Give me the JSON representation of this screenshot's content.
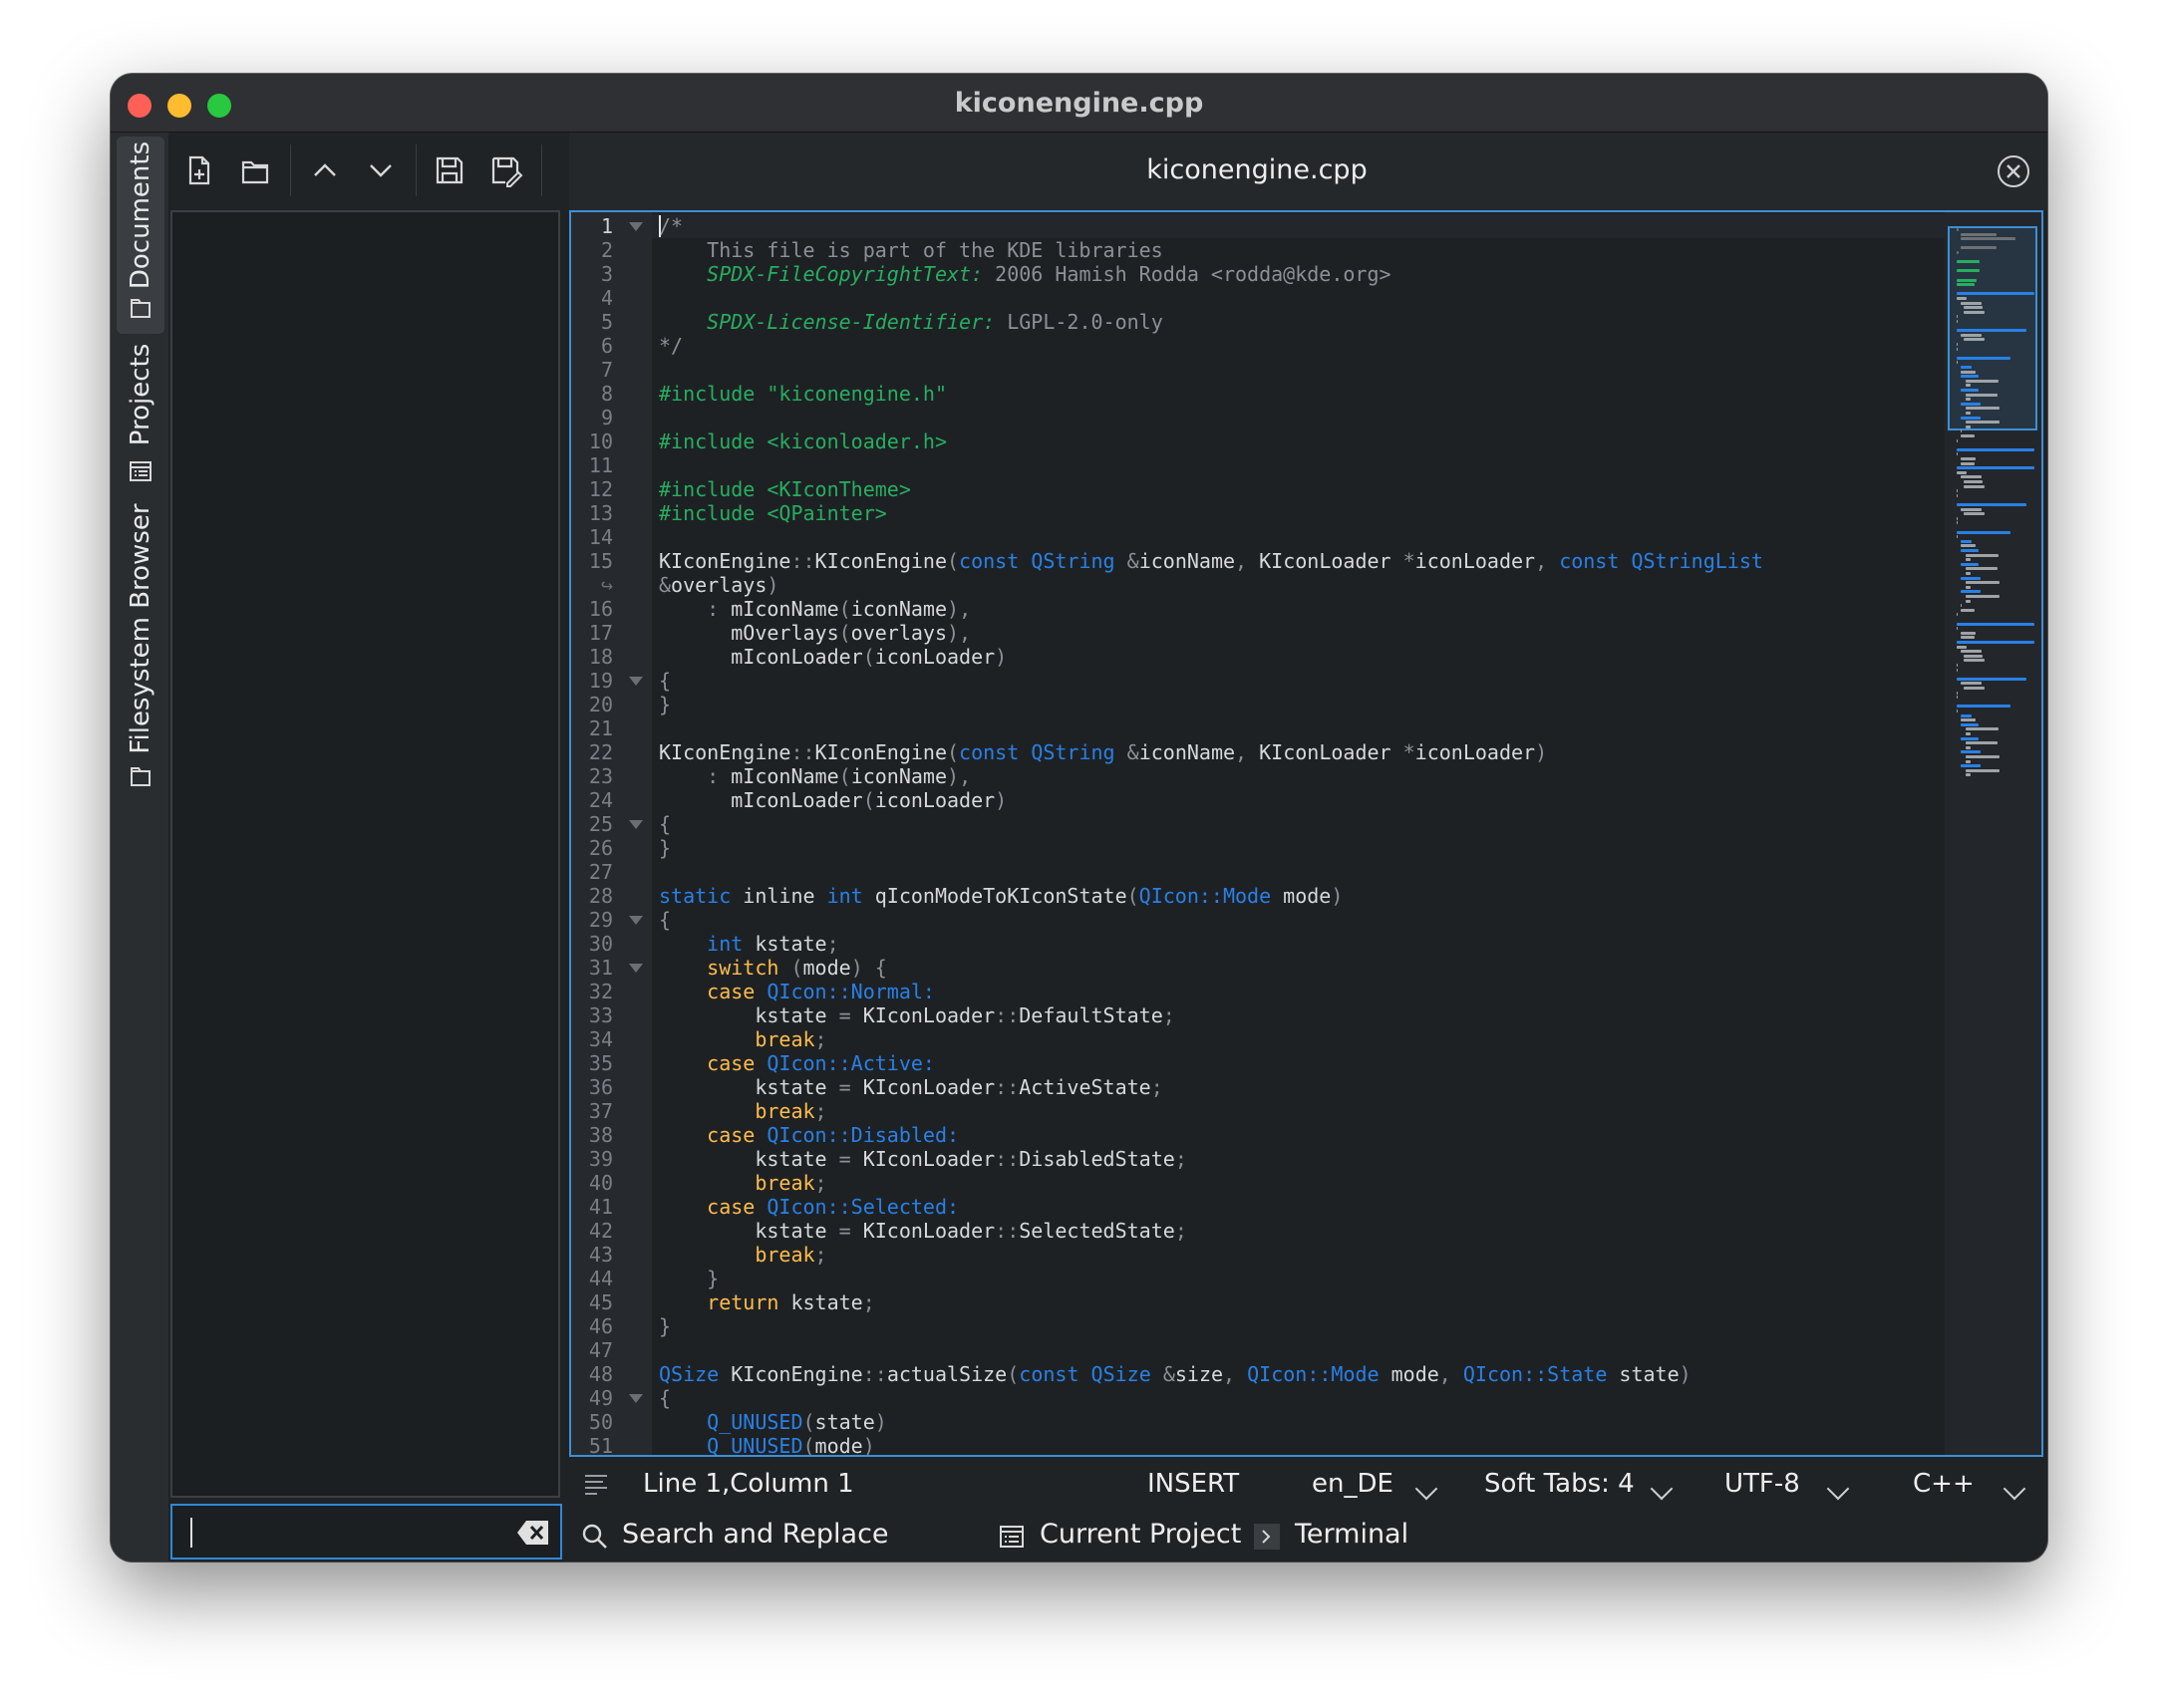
{
  "window": {
    "title": "kiconengine.cpp"
  },
  "sidebar": {
    "tabs": [
      {
        "label": "Documents",
        "icon": "document-stack-icon",
        "active": true
      },
      {
        "label": "Projects",
        "icon": "project-list-icon",
        "active": false
      },
      {
        "label": "Filesystem Browser",
        "icon": "folder-icon",
        "active": false
      }
    ]
  },
  "toolbar": {
    "buttons": [
      "new-document-icon",
      "open-folder-icon",
      "previous-document-icon",
      "next-document-icon",
      "save-icon",
      "save-as-icon"
    ]
  },
  "filter": {
    "value": ""
  },
  "editor": {
    "tab_title": "kiconengine.cpp",
    "current_line": 1,
    "lines": [
      {
        "n": "1",
        "text": "/*",
        "fold": true
      },
      {
        "n": "2",
        "text": "    This file is part of the KDE libraries"
      },
      {
        "n": "3",
        "text": "    SPDX-FileCopyrightText: 2006 Hamish Rodda <rodda@kde.org>"
      },
      {
        "n": "4",
        "text": ""
      },
      {
        "n": "5",
        "text": "    SPDX-License-Identifier: LGPL-2.0-only"
      },
      {
        "n": "6",
        "text": "*/"
      },
      {
        "n": "7",
        "text": ""
      },
      {
        "n": "8",
        "text": "#include \"kiconengine.h\""
      },
      {
        "n": "9",
        "text": ""
      },
      {
        "n": "10",
        "text": "#include <kiconloader.h>"
      },
      {
        "n": "11",
        "text": ""
      },
      {
        "n": "12",
        "text": "#include <KIconTheme>"
      },
      {
        "n": "13",
        "text": "#include <QPainter>"
      },
      {
        "n": "14",
        "text": ""
      },
      {
        "n": "15",
        "text": "KIconEngine::KIconEngine(const QString &iconName, KIconLoader *iconLoader, const QStringList"
      },
      {
        "n": "↪",
        "text": "&overlays)"
      },
      {
        "n": "16",
        "text": "    : mIconName(iconName),"
      },
      {
        "n": "17",
        "text": "      mOverlays(overlays),"
      },
      {
        "n": "18",
        "text": "      mIconLoader(iconLoader)"
      },
      {
        "n": "19",
        "text": "{",
        "fold": true
      },
      {
        "n": "20",
        "text": "}"
      },
      {
        "n": "21",
        "text": ""
      },
      {
        "n": "22",
        "text": "KIconEngine::KIconEngine(const QString &iconName, KIconLoader *iconLoader)"
      },
      {
        "n": "23",
        "text": "    : mIconName(iconName),"
      },
      {
        "n": "24",
        "text": "      mIconLoader(iconLoader)"
      },
      {
        "n": "25",
        "text": "{",
        "fold": true
      },
      {
        "n": "26",
        "text": "}"
      },
      {
        "n": "27",
        "text": ""
      },
      {
        "n": "28",
        "text": "static inline int qIconModeToKIconState(QIcon::Mode mode)"
      },
      {
        "n": "29",
        "text": "{",
        "fold": true
      },
      {
        "n": "30",
        "text": "    int kstate;"
      },
      {
        "n": "31",
        "text": "    switch (mode) {",
        "fold": true
      },
      {
        "n": "32",
        "text": "    case QIcon::Normal:"
      },
      {
        "n": "33",
        "text": "        kstate = KIconLoader::DefaultState;"
      },
      {
        "n": "34",
        "text": "        break;"
      },
      {
        "n": "35",
        "text": "    case QIcon::Active:"
      },
      {
        "n": "36",
        "text": "        kstate = KIconLoader::ActiveState;"
      },
      {
        "n": "37",
        "text": "        break;"
      },
      {
        "n": "38",
        "text": "    case QIcon::Disabled:"
      },
      {
        "n": "39",
        "text": "        kstate = KIconLoader::DisabledState;"
      },
      {
        "n": "40",
        "text": "        break;"
      },
      {
        "n": "41",
        "text": "    case QIcon::Selected:"
      },
      {
        "n": "42",
        "text": "        kstate = KIconLoader::SelectedState;"
      },
      {
        "n": "43",
        "text": "        break;"
      },
      {
        "n": "44",
        "text": "    }"
      },
      {
        "n": "45",
        "text": "    return kstate;"
      },
      {
        "n": "46",
        "text": "}"
      },
      {
        "n": "47",
        "text": ""
      },
      {
        "n": "48",
        "text": "QSize KIconEngine::actualSize(const QSize &size, QIcon::Mode mode, QIcon::State state)"
      },
      {
        "n": "49",
        "text": "{",
        "fold": true
      },
      {
        "n": "50",
        "text": "    Q_UNUSED(state)"
      },
      {
        "n": "51",
        "text": "    Q_UNUSED(mode)"
      }
    ]
  },
  "statusbar": {
    "position": "Line 1,Column 1",
    "mode": "INSERT",
    "language_dict": "en_DE",
    "indentation": "Soft Tabs: 4",
    "encoding": "UTF-8",
    "syntax": "C++"
  },
  "bottom_panels": [
    {
      "label": "Search and Replace",
      "icon": "search-icon"
    },
    {
      "label": "Current Project",
      "icon": "project-list-icon"
    },
    {
      "label": "Terminal",
      "icon": "terminal-icon"
    }
  ],
  "colors": {
    "accent": "#3d8fd6",
    "keyword": "#2980e6",
    "preprocessor": "#27ae60",
    "control_flow": "#fdbc4b",
    "comment": "#8b9196"
  }
}
